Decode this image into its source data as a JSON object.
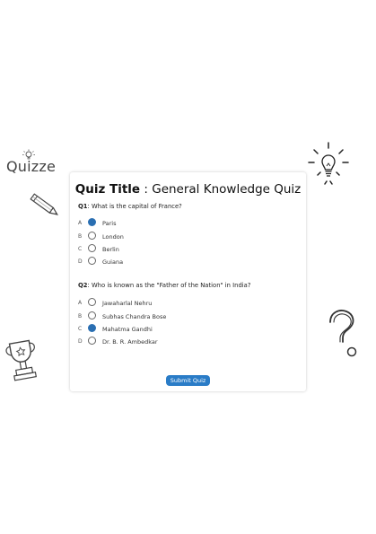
{
  "brand": {
    "name": "Quizze"
  },
  "quiz": {
    "title_label": "Quiz Title",
    "title_sep": " : ",
    "title_value": "General Knowledge Quiz"
  },
  "questions": [
    {
      "number": "Q1",
      "text": ": What is the capital of France?",
      "options": [
        {
          "letter": "A",
          "text": "Paris",
          "selected": true
        },
        {
          "letter": "B",
          "text": "London",
          "selected": false
        },
        {
          "letter": "C",
          "text": "Berlin",
          "selected": false
        },
        {
          "letter": "D",
          "text": "Guiana",
          "selected": false
        }
      ]
    },
    {
      "number": "Q2",
      "text": ": Who is known as the \"Father of the Nation\" in India?",
      "options": [
        {
          "letter": "A",
          "text": "Jawaharlal Nehru",
          "selected": false
        },
        {
          "letter": "B",
          "text": "Subhas Chandra Bose",
          "selected": false
        },
        {
          "letter": "C",
          "text": "Mahatma Gandhi",
          "selected": true
        },
        {
          "letter": "D",
          "text": "Dr. B. R. Ambedkar",
          "selected": false
        }
      ]
    }
  ],
  "submit_label": "Submit Quiz",
  "colors": {
    "accent": "#2a6fb2",
    "button": "#2a7cc7"
  },
  "icons": [
    "lightbulb-icon",
    "pencil-icon",
    "trophy-icon",
    "question-mark-icon"
  ]
}
